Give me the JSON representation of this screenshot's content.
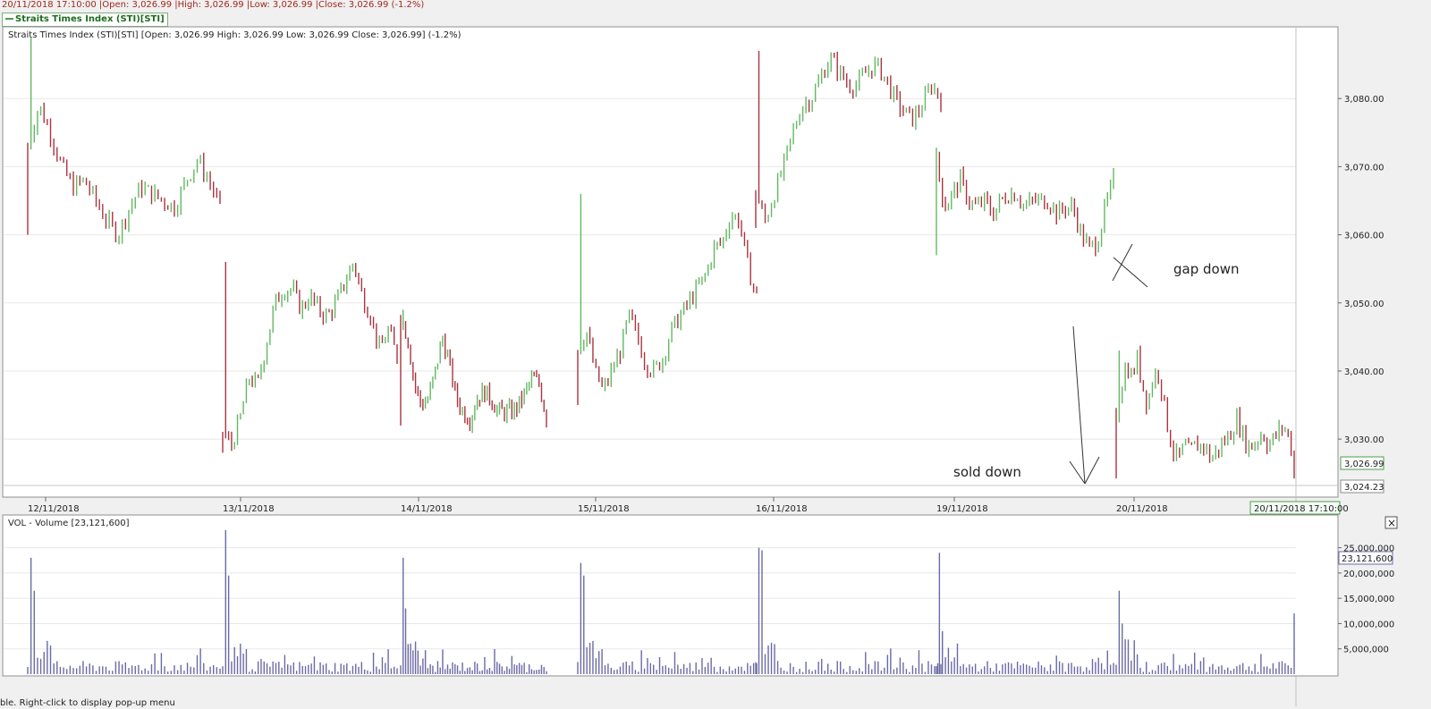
{
  "header": {
    "info_line": "20/11/2018 17:10:00 |Open: 3,026.99 |High: 3,026.99 |Low: 3,026.99 |Close: 3,026.99 (-1.2%)",
    "legend_label": "Straits Times Index (STI)[STI]"
  },
  "price_panel": {
    "title": "Straits Times Index (STI)[STI] [Open: 3,026.99  High: 3,026.99  Low: 3,026.99  Close: 3,026.99] (-1.2%)",
    "last_price_label": "3,026.99",
    "cursor_price_label": "3,024.23",
    "cursor_time_label": "20/11/2018 17:10:00"
  },
  "volume_panel": {
    "title": "VOL - Volume [23,121,600]",
    "last_volume_label": "23,121,600",
    "close_glyph": "×"
  },
  "annotations": {
    "gap_down": "gap down",
    "sold_down": "sold down"
  },
  "status_bar": {
    "text": "ble. Right-click to display pop-up menu"
  },
  "colors": {
    "up_bar": "#62b862",
    "down_bar": "#a9343f",
    "volume_bar": "#6a6aa6",
    "gridline": "#e8e8e8"
  },
  "chart_data": [
    {
      "type": "ohlc",
      "title": "Straits Times Index (STI)[STI]",
      "x_tick_labels": [
        "12/11/2018",
        "13/11/2018",
        "14/11/2018",
        "15/11/2018",
        "16/11/2018",
        "19/11/2018",
        "20/11/2018"
      ],
      "y_tick_labels": [
        "3,030.00",
        "3,040.00",
        "3,050.00",
        "3,060.00",
        "3,070.00",
        "3,080.00"
      ],
      "ylim": [
        3022.8,
        3090
      ],
      "days": [
        {
          "date": "12/11/2018",
          "path": [
            3073,
            3079,
            3075,
            3070,
            3067,
            3068,
            3065,
            3062,
            3060,
            3064,
            3067,
            3066,
            3065,
            3064,
            3068,
            3071,
            3068,
            3064
          ],
          "high": 3089,
          "low": 3060
        },
        {
          "date": "13/11/2018",
          "path": [
            3031,
            3029,
            3033,
            3039,
            3038,
            3044,
            3050,
            3052,
            3052,
            3049,
            3051,
            3049,
            3048,
            3050,
            3053,
            3056,
            3051,
            3048,
            3043,
            3046,
            3042
          ],
          "high": 3056,
          "low": 3028
        },
        {
          "date": "14/11/2018",
          "path": [
            3048,
            3045,
            3038,
            3035,
            3036,
            3040,
            3045,
            3041,
            3036,
            3034,
            3033,
            3036,
            3037,
            3036,
            3034,
            3034,
            3034,
            3035,
            3037,
            3039,
            3038,
            3033
          ],
          "high": 3049,
          "low": 3032
        },
        {
          "date": "15/11/2018",
          "path": [
            3043,
            3046,
            3040,
            3037,
            3040,
            3043,
            3048,
            3045,
            3041,
            3040,
            3042,
            3046,
            3048,
            3050,
            3052,
            3054,
            3058,
            3059,
            3063,
            3062,
            3055,
            3051
          ],
          "high": 3066,
          "low": 3035
        },
        {
          "date": "16/11/2018",
          "path": [
            3066,
            3062,
            3066,
            3070,
            3075,
            3079,
            3080,
            3083,
            3086,
            3084,
            3082,
            3082,
            3084,
            3085,
            3083,
            3080,
            3078,
            3077,
            3079,
            3082,
            3080
          ],
          "high": 3087,
          "low": 3061
        },
        {
          "date": "19/11/2018",
          "path": [
            3071,
            3064,
            3066,
            3068,
            3065,
            3064,
            3065,
            3063,
            3065,
            3066,
            3066,
            3064,
            3065,
            3065,
            3065,
            3063,
            3064,
            3064,
            3060,
            3058,
            3059,
            3064,
            3068
          ],
          "high": 3072,
          "low": 3057
        },
        {
          "date": "20/11/2018",
          "path": [
            3034,
            3038,
            3041,
            3039,
            3042,
            3038,
            3035,
            3039,
            3040,
            3036,
            3031,
            3028,
            3027,
            3029,
            3028,
            3029,
            3029,
            3029,
            3027,
            3028,
            3029,
            3030,
            3031,
            3033,
            3031,
            3029,
            3029,
            3030,
            3031,
            3029,
            3030,
            3031,
            3032,
            3030,
            3027
          ],
          "high": 3043,
          "low": 3024.23
        }
      ],
      "last_close": 3026.99
    },
    {
      "type": "bar",
      "title": "VOL - Volume [23,121,600]",
      "y_tick_labels": [
        "5,000,000",
        "10,000,000",
        "15,000,000",
        "20,000,000",
        "25,000,000"
      ],
      "ylim": [
        0,
        29000000
      ],
      "day_session_spikes": [
        {
          "date": "12/11/2018",
          "opening_volume": 23000000,
          "second_volume": 16500000
        },
        {
          "date": "13/11/2018",
          "opening_volume": 28500000,
          "second_volume": 19500000
        },
        {
          "date": "14/11/2018",
          "opening_volume": 23000000,
          "second_volume": 13000000
        },
        {
          "date": "15/11/2018",
          "opening_volume": 22000000,
          "second_volume": 19500000
        },
        {
          "date": "16/11/2018",
          "opening_volume": 25000000,
          "second_volume": 24500000
        },
        {
          "date": "19/11/2018",
          "opening_volume": 24000000,
          "second_volume": 8500000
        },
        {
          "date": "20/11/2018",
          "opening_volume": 16500000,
          "second_volume": 10000000
        }
      ],
      "last_volume": 23121600
    }
  ]
}
